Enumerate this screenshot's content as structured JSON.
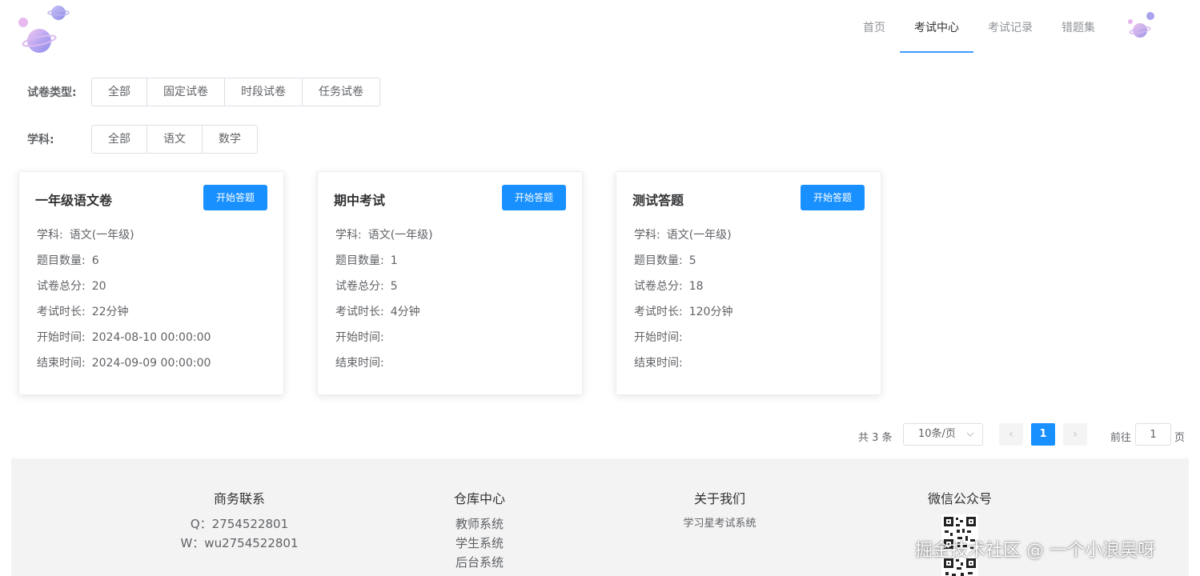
{
  "nav": {
    "items": [
      {
        "label": "首页",
        "active": false
      },
      {
        "label": "考试中心",
        "active": true
      },
      {
        "label": "考试记录",
        "active": false
      },
      {
        "label": "错题集",
        "active": false
      }
    ],
    "accent": "#409eff"
  },
  "filters": {
    "paper_type": {
      "label": "试卷类型:",
      "options": [
        "全部",
        "固定试卷",
        "时段试卷",
        "任务试卷"
      ]
    },
    "subject": {
      "label": "学科:",
      "options": [
        "全部",
        "语文",
        "数学"
      ]
    }
  },
  "card_labels": {
    "subject": "学科:",
    "count": "题目数量:",
    "score": "试卷总分:",
    "duration": "考试时长:",
    "start": "开始时间:",
    "end": "结束时间:"
  },
  "cards": [
    {
      "title": "一年级语文卷",
      "button": "开始答题",
      "subject": "语文(一年级)",
      "count": "6",
      "score": "20",
      "duration": "22分钟",
      "start": "2024-08-10 00:00:00",
      "end": "2024-09-09 00:00:00"
    },
    {
      "title": "期中考试",
      "button": "开始答题",
      "subject": "语文(一年级)",
      "count": "1",
      "score": "5",
      "duration": "4分钟",
      "start": "",
      "end": ""
    },
    {
      "title": "测试答题",
      "button": "开始答题",
      "subject": "语文(一年级)",
      "count": "5",
      "score": "18",
      "duration": "120分钟",
      "start": "",
      "end": ""
    }
  ],
  "pagination": {
    "total_text": "共 3 条",
    "page_size": "10条/页",
    "prev_icon": "‹",
    "next_icon": "›",
    "current_page": "1",
    "goto_label": "前往",
    "goto_value": "1",
    "page_unit": "页"
  },
  "footer": {
    "business": {
      "title": "商务联系",
      "lines": [
        "Q：2754522801",
        "W：wu2754522801"
      ]
    },
    "warehouse": {
      "title": "仓库中心",
      "lines": [
        "教师系统",
        "学生系统",
        "后台系统"
      ]
    },
    "about": {
      "title": "关于我们",
      "lines": [
        "学习星考试系统"
      ]
    },
    "wechat": {
      "title": "微信公众号"
    }
  },
  "watermark": "掘金技术社区 @ 一个小浪吴呀",
  "colors": {
    "primary_button": "#1890ff",
    "footer_bg": "#f3f3f3"
  }
}
